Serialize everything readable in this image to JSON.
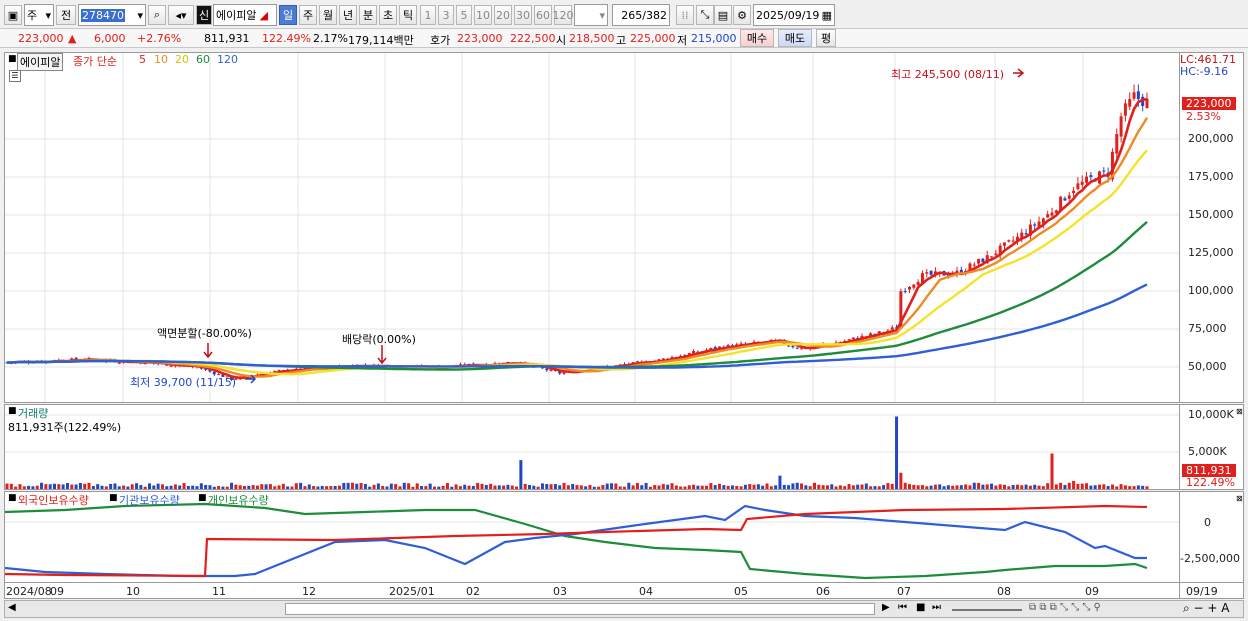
{
  "toolbar": {
    "type_sel": "주",
    "prev": "전",
    "code": "278470",
    "new_badge": "신",
    "stock_name": "에이피알",
    "periods": [
      "일",
      "주",
      "월",
      "년",
      "분",
      "초",
      "틱"
    ],
    "intervals": [
      "1",
      "3",
      "5",
      "10",
      "20",
      "30",
      "60",
      "120"
    ],
    "count": "265",
    "total": "/382",
    "date": "2025/09/19"
  },
  "quote": {
    "price": "223,000",
    "arrow": "▲",
    "change": "6,000",
    "rate": "+2.76%",
    "volume": "811,931",
    "vol_ratio": "122.49%",
    "turnover": "2.17%",
    "amount": "179,114백만",
    "bid_label": "호가",
    "bid": "223,000",
    "ask": "222,500",
    "open_label": "시",
    "open": "218,500",
    "high_label": "고",
    "high": "225,000",
    "low_label": "저",
    "low": "215,000",
    "buy": "매수",
    "sell": "매도",
    "eval": "평"
  },
  "price_panel": {
    "name_tag": "에이피알",
    "legend": {
      "title": "종가 단순",
      "ma": [
        "5",
        "10",
        "20",
        "60",
        "120"
      ]
    },
    "annotations": {
      "high": "최고 245,500 (08/11)",
      "low": "최저 39,700 (11/15)",
      "split": "액면분할(-80.00%)",
      "dividend": "배당락(0.00%)"
    },
    "lc": "LC:461.71",
    "hc": "HC:-9.16",
    "cur_price": "223,000",
    "cur_rate": "2.53%",
    "yticks": [
      "200,000",
      "175,000",
      "150,000",
      "125,000",
      "100,000",
      "75,000",
      "50,000"
    ],
    "colors": {
      "ma5": "#e0201c",
      "ma10": "#f08a24",
      "ma20": "#f5e22a",
      "ma60": "#1e8c3a",
      "ma120": "#2f5fd6",
      "up": "#e0201c",
      "down": "#2147c4"
    }
  },
  "volume_panel": {
    "title": "거래량",
    "value": "811,931주(122.49%)",
    "yticks": [
      "10,000K",
      "5,000K"
    ],
    "cur": "811,931",
    "cur_rate": "122.49%"
  },
  "holding_panel": {
    "legend": [
      "외국인보유수량",
      "기관보유수량",
      "개인보유수량"
    ],
    "yticks": [
      "0",
      "-2,500,000"
    ]
  },
  "xaxis": {
    "labels": [
      "2024/08",
      "09",
      "10",
      "11",
      "12",
      "2025/01",
      "02",
      "03",
      "04",
      "05",
      "06",
      "07",
      "08",
      "09"
    ],
    "right": "09/19"
  }
}
